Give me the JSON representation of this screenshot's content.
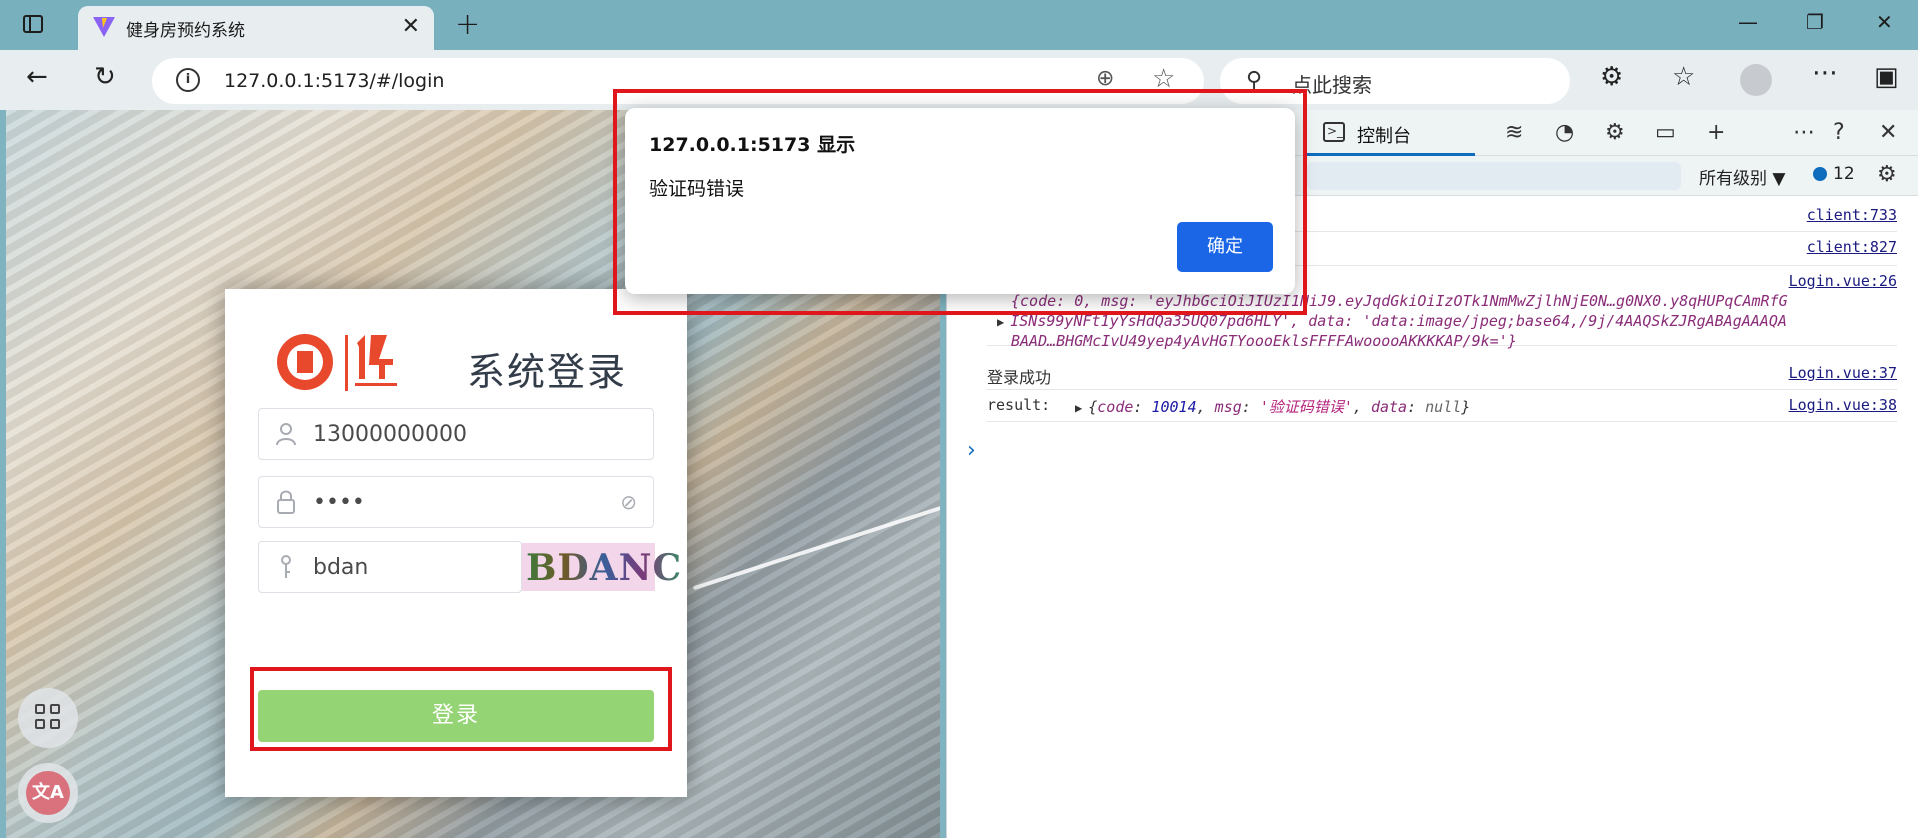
{
  "browser": {
    "tab_title": "健身房预约系统",
    "url": "127.0.0.1:5173/#/login",
    "search_placeholder": "点此搜索"
  },
  "login": {
    "title": "系统登录",
    "username": "13000000000",
    "password_masked": "••••",
    "captcha_input": "bdan",
    "captcha_image_text": "BDANC",
    "submit_label": "登录"
  },
  "alert": {
    "title": "127.0.0.1:5173 显示",
    "message": "验证码错误",
    "ok_label": "确定"
  },
  "devtools": {
    "console_tab": "控制台",
    "levels_label": "所有级别",
    "issues_count": "12",
    "logs": [
      {
        "source": "client:733"
      },
      {
        "source": "client:827"
      },
      {
        "source": "Login.vue:26",
        "line1": "{code: 0, msg: 'eyJhbGciOiJIUzI1NiJ9.eyJqdGkiOiIzOTk1NmMwZjlhNjE0N…g0NX0.y8qHUPqCAmRfG",
        "line2": "ISNs99yNFt1yYsHdQa35UQ07pd6HLY', data: 'data:image/jpeg;base64,/9j/4AAQSkZJRgABAgAAAQA",
        "line3": "BAAD…BHGMcIvU49yep4yAvHGTYoooEklsFFFFAwooooAKKKKAP/9k='}"
      },
      {
        "source": "Login.vue:37",
        "text": "登录成功"
      },
      {
        "source": "Login.vue:38",
        "label": "result:",
        "code_key": "code",
        "code_val": "10014",
        "msg_key": "msg",
        "msg_val": "'验证码错误'",
        "data_key": "data",
        "data_val": "null"
      }
    ]
  },
  "colors": {
    "accent": "#0f6cbd",
    "login_button": "#95d475",
    "alert_button": "#1a66e6",
    "highlight": "#e0161d"
  }
}
